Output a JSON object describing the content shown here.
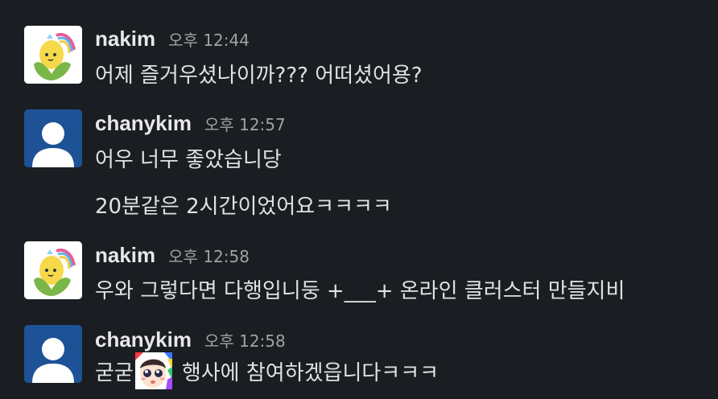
{
  "messages": [
    {
      "user": "nakim",
      "time": "오후 12:44",
      "avatar_icon": "corn-mascot-icon",
      "lines": [
        "어제 즐거우셨나이까??? 어떠셨어용?"
      ]
    },
    {
      "user": "chanykim",
      "time": "오후 12:57",
      "avatar_icon": "default-user-icon",
      "lines": [
        "어우 너무 좋았습니당",
        "20분같은 2시간이었어요ㅋㅋㅋㅋ"
      ]
    },
    {
      "user": "nakim",
      "time": "오후 12:58",
      "avatar_icon": "corn-mascot-icon",
      "lines": [
        "우와 그렇다면 다행입니둥 +___+ 온라인 클러스터 만들지비"
      ]
    },
    {
      "user": "chanykim",
      "time": "오후 12:58",
      "avatar_icon": "default-user-icon",
      "line_before_emoji": "굳굳",
      "emoji_icon": "sparkle-eyes-face-emoji",
      "line_after_emoji": "행사에 참여하겠읍니다ㅋㅋㅋ"
    }
  ],
  "colors": {
    "background": "#1a1d21",
    "default_avatar_bg": "#1d5296",
    "corn_avatar_bg": "#ffffff"
  }
}
